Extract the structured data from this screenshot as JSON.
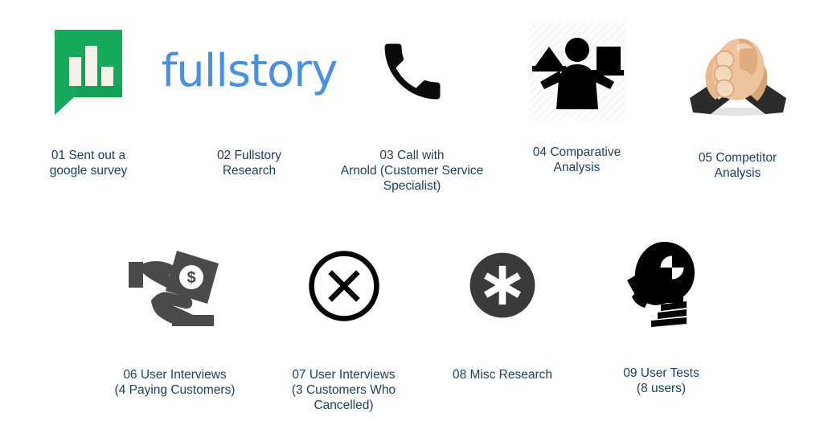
{
  "slide": {
    "background_color": "#ffffff",
    "caption_color": "#1f4257",
    "items": [
      {
        "number": "01",
        "caption": "01 Sent out a\ngoogle survey",
        "icon_name": "google-surveys-icon",
        "icon_colors": {
          "bubble": "#17a95c",
          "bars": "#f2f0e6",
          "shadow": "#0f8a49"
        }
      },
      {
        "number": "02",
        "caption": "02 Fullstory\nResearch",
        "icon_name": "fullstory-wordmark-logo",
        "wordmark_text": "fullstory",
        "icon_colors": {
          "brand": "#4a90e2"
        }
      },
      {
        "number": "03",
        "caption": "03 Call with\nArnold (Customer Service\nSpecialist)",
        "icon_name": "phone-call-icon",
        "icon_colors": {
          "glyph": "#0a0a0a"
        }
      },
      {
        "number": "04",
        "caption": "04 Comparative\nAnalysis",
        "icon_name": "comparative-analysis-person-icon",
        "icon_colors": {
          "glyph": "#000000",
          "backdrop": "#fcfcfc",
          "hatch": "#eeeeee"
        }
      },
      {
        "number": "05",
        "caption": "05 Competitor\nAnalysis",
        "icon_name": "arm-wrestling-handshake-icon",
        "icon_colors": {
          "skin": "#e8b98f",
          "skin_light": "#f5d9bd",
          "skin_dark": "#c99466",
          "sleeve": "#2b2b2b",
          "cuff": "#ffffff"
        }
      },
      {
        "number": "06",
        "caption": "06 User Interviews\n(4 Paying Customers)",
        "icon_name": "money-exchange-hands-icon",
        "icon_colors": {
          "glyph": "#4a4a4a"
        }
      },
      {
        "number": "07",
        "caption": "07 User Interviews\n(3 Customers Who\nCancelled)",
        "icon_name": "circle-x-cancel-icon",
        "icon_colors": {
          "glyph": "#000000"
        }
      },
      {
        "number": "08",
        "caption": "08 Misc Research",
        "icon_name": "asterisk-circle-icon",
        "icon_colors": {
          "circle": "#3a3a3a",
          "glyph": "#ffffff"
        }
      },
      {
        "number": "09",
        "caption": "09 User Tests\n(8 users)",
        "icon_name": "crash-test-dummy-head-icon",
        "icon_colors": {
          "glyph": "#000000"
        }
      }
    ]
  }
}
